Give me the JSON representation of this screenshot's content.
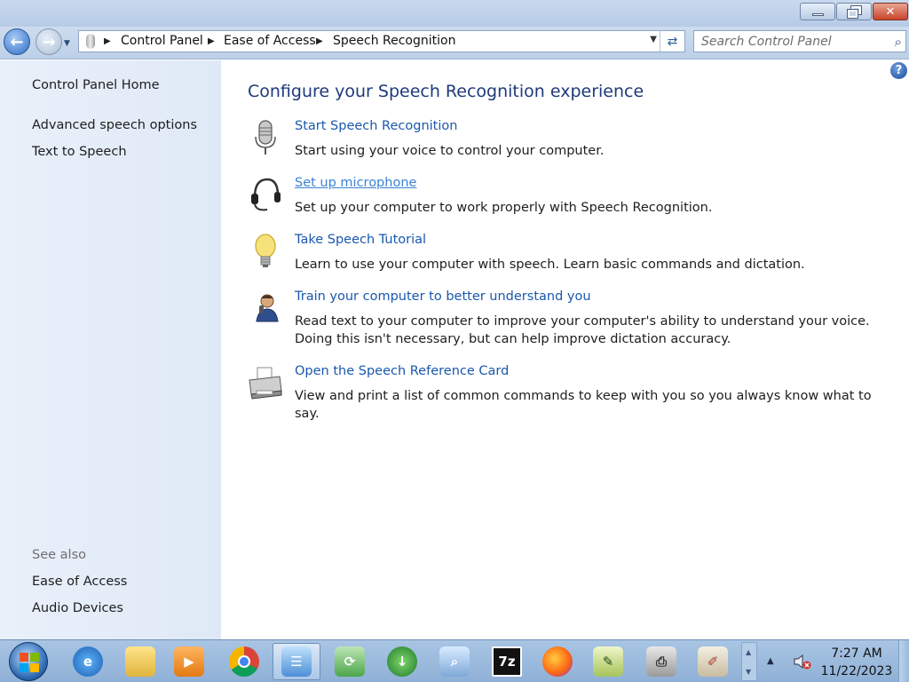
{
  "window": {
    "controls": {
      "minimize_icon": "minimize-icon",
      "maximize_icon": "restore-icon",
      "close_icon": "close-icon"
    }
  },
  "navigation": {
    "breadcrumbs": [
      "Control Panel",
      "Ease of Access",
      "Speech Recognition"
    ],
    "search_placeholder": "Search Control Panel"
  },
  "sidebar": {
    "home": "Control Panel Home",
    "links": [
      "Advanced speech options",
      "Text to Speech"
    ],
    "see_also_label": "See also",
    "see_also": [
      "Ease of Access",
      "Audio Devices"
    ]
  },
  "main": {
    "heading": "Configure your Speech Recognition experience",
    "tasks": [
      {
        "icon": "microphone-icon",
        "title": "Start Speech Recognition",
        "description": "Start using your voice to control your computer."
      },
      {
        "icon": "headset-icon",
        "title": "Set up microphone",
        "description": "Set up your computer to work properly with Speech Recognition."
      },
      {
        "icon": "lightbulb-icon",
        "title": "Take Speech Tutorial",
        "description": "Learn to use your computer with speech.  Learn basic commands and dictation."
      },
      {
        "icon": "user-train-icon",
        "title": "Train your computer to better understand you",
        "description": "Read text to your computer to improve your computer's ability to understand your voice.  Doing this isn't necessary, but can help improve dictation accuracy."
      },
      {
        "icon": "printer-icon",
        "title": "Open the Speech Reference Card",
        "description": "View and print a list of common commands to keep with you so you always know what to say."
      }
    ]
  },
  "taskbar": {
    "apps": [
      "internet-explorer-icon",
      "file-explorer-icon",
      "media-player-icon",
      "chrome-icon",
      "control-panel-icon",
      "sync-center-icon",
      "download-manager-icon",
      "search-network-icon",
      "7zip-icon",
      "firefox-icon",
      "notepad-icon",
      "fax-icon",
      "paint-icon"
    ],
    "time": "7:27 AM",
    "date": "11/22/2023"
  },
  "colors": {
    "link": "#1a58ad",
    "heading": "#1e3a7a",
    "sidebar_bg": "#e5eef9"
  }
}
